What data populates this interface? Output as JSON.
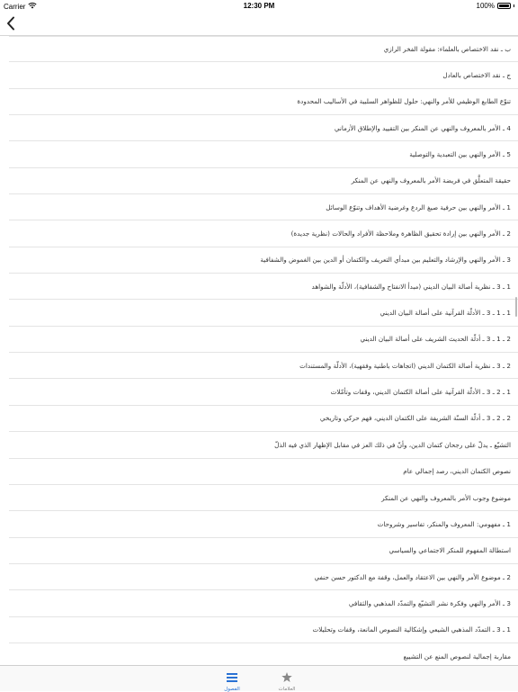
{
  "status_bar": {
    "carrier": "Carrier",
    "time": "12:30 PM",
    "battery": "100%"
  },
  "navbar": {
    "back_icon": "chevron-left-icon"
  },
  "colors": {
    "accent": "#2a72d4",
    "inactive": "#888888",
    "separator": "#e4e4e4"
  },
  "list": {
    "items": [
      "ب ـ نقد الاختصاص بالعلماء: مقولة الفخر الرازي",
      "ج ـ نقد الاختصاص بالعادل",
      "تنوّع الطابع الوظيفي للأمر والنهي: حلول للظواهر السلبية في الأساليب المحدودة",
      "4 ـ الأمر بالمعروف والنهي عن المنكر بين التقييد والإطلاق الأزماني",
      "5 ـ الأمر والنهي بين التعبدية والتوصلية",
      "حقيقة المتعلَّق في فريضة الأمر بالمعروف والنهي عن المنكر",
      "1 ـ الأمر والنهي بين حرفية صيغ الردع وغرضية الأهداف وتنوّع الوسائل",
      "2 ـ الأمر والنهي بين إرادة تحقيق الظاهرة وملاحظة الأفراد والحالات (نظرية جديدة)",
      "3 ـ الأمر والنهي والإرشاد والتعليم بين مبدأي التعريف والكتمان أو الدين بين الغموض والشفافية",
      "1 ـ 3 ـ نظرية أصالة البيان الديني (مبدأ الانفتاح والشفافية)، الأدلّة والشواهد",
      "1 ـ 1 ـ 3 ـ الأدلّة القرآنية على أصالة البيان الديني",
      "2 ـ 1 ـ 3 ـ أدلّة الحديث الشريف على أصالة البيان الديني",
      "2 ـ 3 ـ نظرية أصالة الكتمان الديني (اتجاهات باطنية وفقهية)، الأدلّة والمستندات",
      "1 ـ 2 ـ 3 ـ الأدلّة القرآنية على أصالة الكتمان الديني، وقفات وتأمّلات",
      "2 ـ 2 ـ 3 ـ أدلّة السنّة الشريفة على الكتمان الديني، فهم حركي وتاريخي",
      "التشيّع ـ يدلّ على رجحان كتمان الدين، وأنّ في ذلك العز في مقابل الإظهار الذي فيه الذلّ",
      "نصوص الكتمان الديني، رصد إجمالي عام",
      "موضوع وجوب الأمر بالمعروف والنهي عن المنكر",
      "1 ـ مفهومي: المعروف والمنكر، تفاسير وشروحات",
      "استطالة المفهوم للمنكر الاجتماعي والسياسي",
      "2 ـ موضوع الأمر والنهي بين الاعتقاد والعمل، وقفة مع الدكتور حسن حنفي",
      "3 ـ الأمر والنهي وفكرة نشر التشيّع والتمدّد المذهبي والثقافي",
      "1 ـ 3 ـ التمدّد المذهبي الشيعي وإشكالية النصوص المانعة، وقفات وتحليلات",
      "مقاربة إجمالية لنصوص المنع عن التشييع"
    ]
  },
  "tabbar": {
    "tabs": [
      {
        "label": "الفصول",
        "icon": "list-icon",
        "active": true
      },
      {
        "label": "العلامات",
        "icon": "star-icon",
        "active": false
      }
    ]
  }
}
